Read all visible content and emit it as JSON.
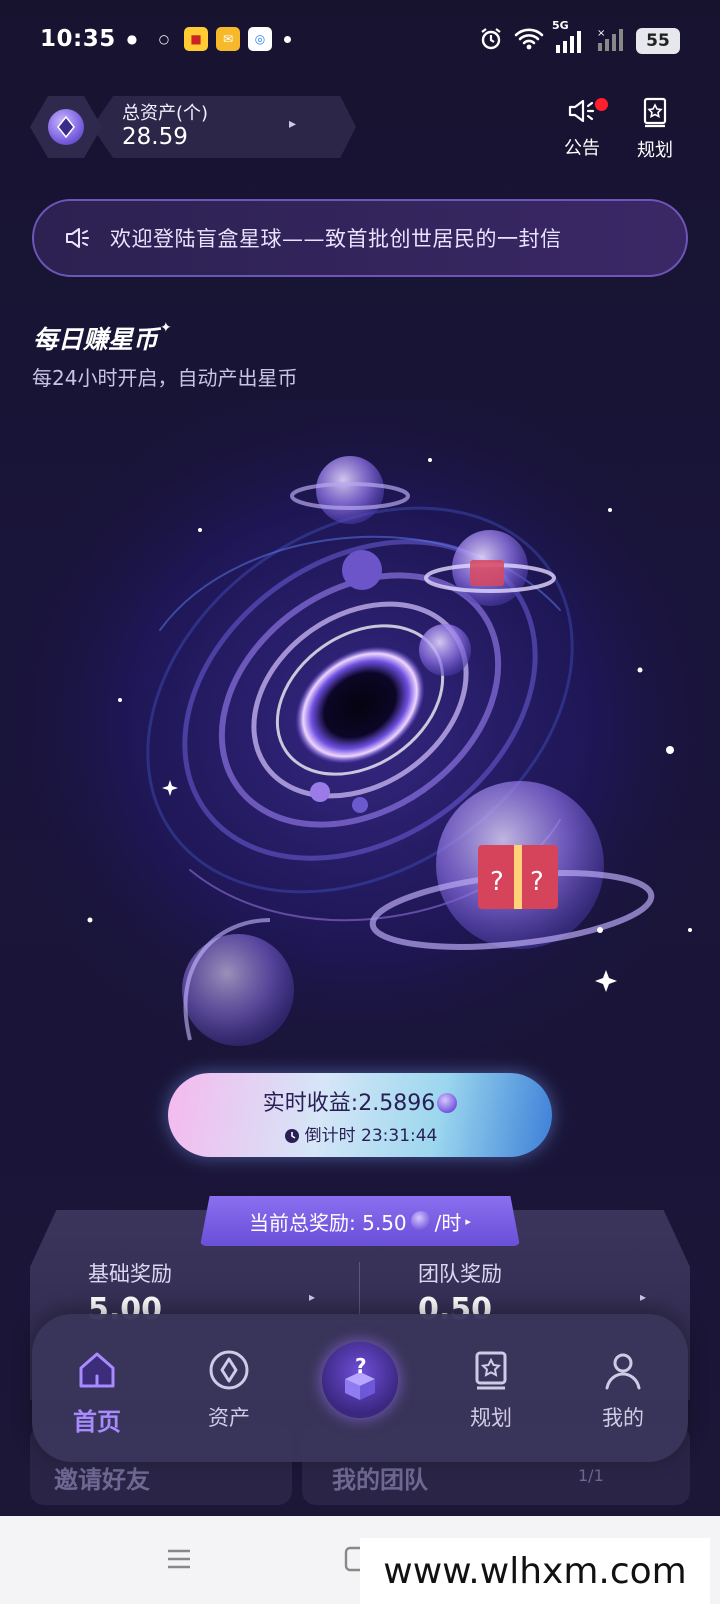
{
  "status_bar": {
    "time": "10:35",
    "battery": "55",
    "network": "5G",
    "app_icons": [
      "wechat-icon",
      "alipay-icon",
      "pinduoduo-icon",
      "mail-icon",
      "location-icon"
    ]
  },
  "header": {
    "asset_label": "总资产(个)",
    "asset_value": "28.59",
    "announcement_label": "公告",
    "plan_label": "规划"
  },
  "notice": {
    "text": "欢迎登陆盲盒星球——致首批创世居民的一封信"
  },
  "daily": {
    "title": "每日赚星币",
    "subtitle": "每24小时开启，自动产出星币"
  },
  "earnings": {
    "realtime": "实时收益:2.5896",
    "countdown": "倒计时 23:31:44"
  },
  "rewards": {
    "total": "当前总奖励: 5.50",
    "per_hour": "/时",
    "basic_title": "基础奖励",
    "basic_value": "5.00",
    "team_title": "团队奖励",
    "team_value": "0.50"
  },
  "bottom_cards": {
    "invite": "邀请好友",
    "team": "我的团队",
    "team_count": "1/1"
  },
  "tabbar": {
    "home": "首页",
    "assets": "资产",
    "plan": "规划",
    "mine": "我的"
  },
  "watermark": "www.wlhxm.com",
  "colors": {
    "accent": "#a78bff",
    "background": "#17132f",
    "red_dot": "#ff1f2d"
  }
}
